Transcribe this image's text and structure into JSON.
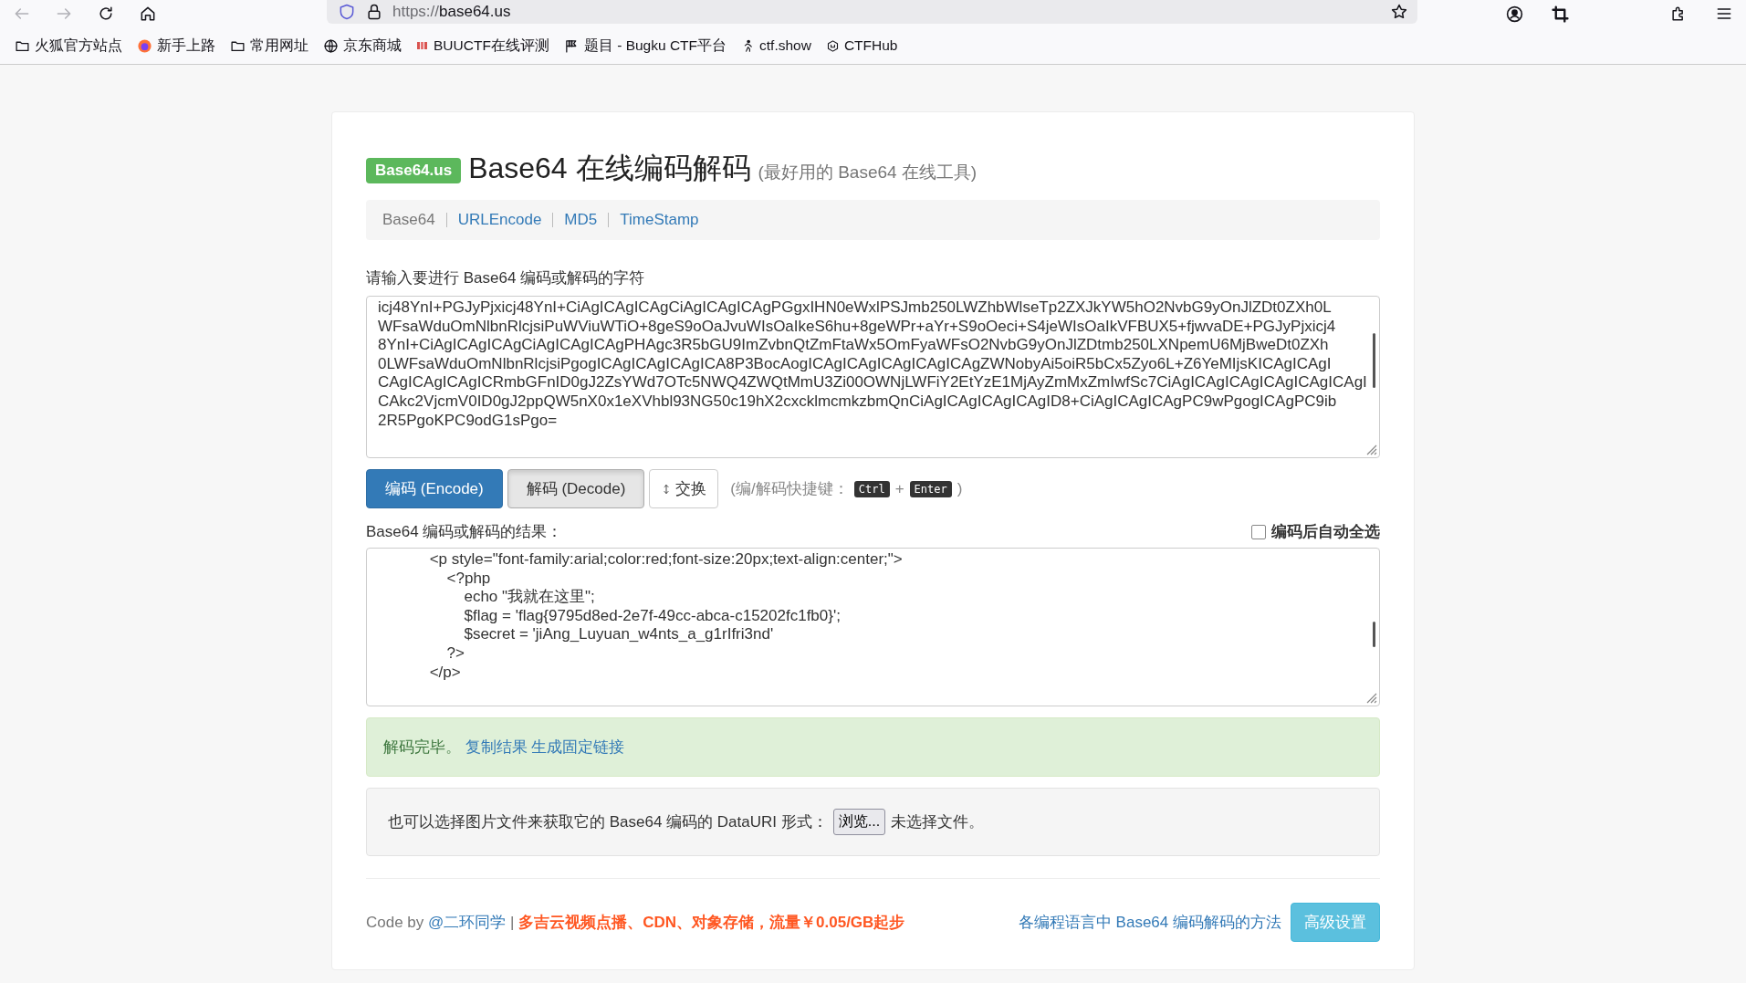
{
  "browser": {
    "url_scheme": "https://",
    "url_host": "base64.us",
    "back_disabled": true,
    "forward_disabled": true,
    "bookmarks": [
      {
        "label": "火狐官方站点",
        "kind": "folder"
      },
      {
        "label": "新手上路",
        "kind": "firefox"
      },
      {
        "label": "常用网址",
        "kind": "folder"
      },
      {
        "label": "京东商城",
        "kind": "globe"
      },
      {
        "label": "BUUCTF在线评测",
        "kind": "buu"
      },
      {
        "label": "题目 - Bugku CTF平台",
        "kind": "flag"
      },
      {
        "label": "ctf.show",
        "kind": "runner"
      },
      {
        "label": "CTFHub",
        "kind": "hub"
      }
    ]
  },
  "header": {
    "badge": "Base64.us",
    "title": "Base64 在线编码解码",
    "subtitle": "(最好用的 Base64 在线工具)"
  },
  "nav": [
    {
      "label": "Base64",
      "selected": true
    },
    {
      "label": "URLEncode",
      "selected": false
    },
    {
      "label": "MD5",
      "selected": false
    },
    {
      "label": "TimeStamp",
      "selected": false
    }
  ],
  "input": {
    "label": "请输入要进行 Base64 编码或解码的字符",
    "lines": [
      "icj48YnI+PGJyPjxicj48YnI+CiAgICAgICAgCiAgICAgICAgPGgxIHN0eWxlPSJmb250LWZhbWlseTp2ZXJkYW5hO2NvbG9yOnJlZDt0ZXh0L",
      "WFsaWduOmNlbnRlcjsiPuWViuWTiO+8geS9oOaJvuWIsOaIkeS6hu+8geWPr+aYr+S9oOeci+S4jeWIsOaIkVFBUX5+fjwvaDE+PGJyPjxicj4",
      "8YnI+CiAgICAgICAgCiAgICAgICAgPHAgc3R5bGU9ImZvbnQtZmFtaWx5OmFyaWFsO2NvbG9yOnJlZDtmb250LXNpemU6MjBweDt0ZXh",
      "0LWFsaWduOmNlbnRlcjsiPgogICAgICAgICAgICA8P3BocAogICAgICAgICAgICAgICAgZWNobyAi5oiR5bCx5Zyo6L+Z6YeMIjsKICAgICAgI",
      "CAgICAgICAgICRmbGFnID0gJ2ZsYWd7OTc5NWQ4ZWQtMmU3Zi00OWNjLWFiY2EtYzE1MjAyZmMxZmIwfSc7CiAgICAgICAgICAgICAgICAgI",
      "CAkc2VjcmV0ID0gJ2ppQW5nX0x1eXVhbl93NG50c19hX2cxcklmcmkzbmQnCiAgICAgICAgICAgID8+CiAgICAgICAgPC9wPgogICAgPC9ib",
      "2R5PgoKPC9odG1sPgo="
    ]
  },
  "buttons": [
    {
      "label": "编码 (Encode)",
      "kind": "primary",
      "pressed": false
    },
    {
      "label": "解码 (Decode)",
      "kind": "default",
      "pressed": true
    },
    {
      "label": "交换",
      "kind": "swap",
      "pressed": false
    }
  ],
  "shortcut": {
    "prefix": "(编/解码快捷键：",
    "keys": [
      "Ctrl",
      "Enter"
    ],
    "joiner": "+",
    "suffix": ")"
  },
  "output": {
    "label": "Base64 编码或解码的结果：",
    "auto_select": {
      "label": "编码后自动全选",
      "checked": false
    },
    "lines": [
      "            <p style=\"font-family:arial;color:red;font-size:20px;text-align:center;\">",
      "                <?php",
      "                    echo \"我就在这里\";",
      "                    $flag = 'flag{9795d8ed-2e7f-49cc-abca-c15202fc1fb0}';",
      "                    $secret = 'jiAng_Luyuan_w4nts_a_g1rIfri3nd'",
      "                ?>",
      "            </p>"
    ]
  },
  "alert": {
    "message": "解码完毕。",
    "links": [
      "复制结果",
      "生成固定链接"
    ]
  },
  "file": {
    "label": "也可以选择图片文件来获取它的 Base64 编码的 DataURI 形式：",
    "button": "浏览...",
    "status": "未选择文件。"
  },
  "footer": {
    "prefix": "Code by",
    "author": "@二环同学",
    "separator": "|",
    "ad": "多吉云视频点播、CDN、对象存储，流量￥0.05/GB起步",
    "guide": "各编程语言中 Base64 编码解码的方法",
    "settings": "高级设置"
  }
}
